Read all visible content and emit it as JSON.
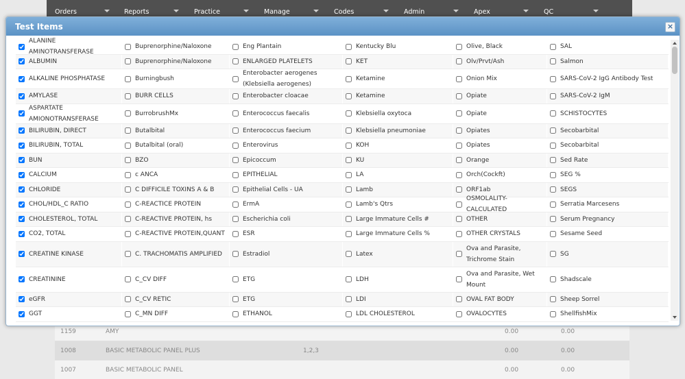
{
  "nav": [
    "Orders",
    "Reports",
    "Practice",
    "Manage",
    "Codes",
    "Admin",
    "Apex",
    "QC"
  ],
  "modal": {
    "title": "Test Items",
    "close_symbol": "×",
    "rows": [
      [
        [
          "ALANINE AMINOTRANSFERASE",
          true
        ],
        [
          "Buprenorphine/Naloxone",
          false
        ],
        [
          "Eng Plantain",
          false
        ],
        [
          "Kentucky Blu",
          false
        ],
        [
          "Olive, Black",
          false
        ],
        [
          "SAL",
          false
        ]
      ],
      [
        [
          "ALBUMIN",
          true
        ],
        [
          "Buprenorphine/Naloxone",
          false
        ],
        [
          "ENLARGED PLATELETS",
          false
        ],
        [
          "KET",
          false
        ],
        [
          "Olv/Prvt/Ash",
          false
        ],
        [
          "Salmon",
          false
        ]
      ],
      [
        [
          "ALKALINE PHOSPHATASE",
          true
        ],
        [
          "Burningbush",
          false
        ],
        [
          "Enterobacter aerogenes (Klebsiella aerogenes)",
          false
        ],
        [
          "Ketamine",
          false
        ],
        [
          "Onion Mix",
          false
        ],
        [
          "SARS-CoV-2 IgG Antibody Test",
          false
        ]
      ],
      [
        [
          "AMYLASE",
          true
        ],
        [
          "BURR CELLS",
          false
        ],
        [
          "Enterobacter cloacae",
          false
        ],
        [
          "Ketamine",
          false
        ],
        [
          "Opiate",
          false
        ],
        [
          "SARS-CoV-2 IgM",
          false
        ]
      ],
      [
        [
          "ASPARTATE AMIONOTRANSFERASE",
          true
        ],
        [
          "BurrobrushMx",
          false
        ],
        [
          "Enterococcus faecalis",
          false
        ],
        [
          "Klebsiella oxytoca",
          false
        ],
        [
          "Opiate",
          false
        ],
        [
          "SCHISTOCYTES",
          false
        ]
      ],
      [
        [
          "BILIRUBIN, DIRECT",
          true
        ],
        [
          "Butalbital",
          false
        ],
        [
          "Enterococcus faecium",
          false
        ],
        [
          "Klebsiella pneumoniae",
          false
        ],
        [
          "Opiates",
          false
        ],
        [
          "Secobarbital",
          false
        ]
      ],
      [
        [
          "BILIRUBIN, TOTAL",
          true
        ],
        [
          "Butalbital (oral)",
          false
        ],
        [
          "Enterovirus",
          false
        ],
        [
          "KOH",
          false
        ],
        [
          "Opiates",
          false
        ],
        [
          "Secobarbital",
          false
        ]
      ],
      [
        [
          "BUN",
          true
        ],
        [
          "BZO",
          false
        ],
        [
          "Epicoccum",
          false
        ],
        [
          "KU",
          false
        ],
        [
          "Orange",
          false
        ],
        [
          "Sed Rate",
          false
        ]
      ],
      [
        [
          "CALCIUM",
          true
        ],
        [
          "c ANCA",
          false
        ],
        [
          "EPITHELIAL",
          false
        ],
        [
          "LA",
          false
        ],
        [
          "Orch(Cockft)",
          false
        ],
        [
          "SEG %",
          false
        ]
      ],
      [
        [
          "CHLORIDE",
          true
        ],
        [
          "C DIFFICILE TOXINS A & B",
          false
        ],
        [
          "Epithelial Cells - UA",
          false
        ],
        [
          "Lamb",
          false
        ],
        [
          "ORF1ab",
          false
        ],
        [
          "SEGS",
          false
        ]
      ],
      [
        [
          "CHOL/HDL_C RATIO",
          true
        ],
        [
          "C-REACTICE PROTEIN",
          false
        ],
        [
          "ErmA",
          false
        ],
        [
          "Lamb's Qtrs",
          false
        ],
        [
          "OSMOLALITY-CALCULATED",
          false
        ],
        [
          "Serratia Marcesens",
          false
        ]
      ],
      [
        [
          "CHOLESTEROL, TOTAL",
          true
        ],
        [
          "C-REACTIVE PROTEIN, hs",
          false
        ],
        [
          "Escherichia coli",
          false
        ],
        [
          "Large Immature Cells #",
          false
        ],
        [
          "OTHER",
          false
        ],
        [
          "Serum Pregnancy",
          false
        ]
      ],
      [
        [
          "CO2, TOTAL",
          true
        ],
        [
          "C-REACTIVE PROTEIN,QUANT",
          false
        ],
        [
          "ESR",
          false
        ],
        [
          "Large Immature Cells %",
          false
        ],
        [
          "OTHER CRYSTALS",
          false
        ],
        [
          "Sesame Seed",
          false
        ]
      ],
      [
        [
          "CREATINE KINASE",
          true
        ],
        [
          "C. TRACHOMATIS AMPLIFIED",
          false
        ],
        [
          "Estradiol",
          false
        ],
        [
          "Latex",
          false
        ],
        [
          "Ova and Parasite, Trichrome Stain",
          false
        ],
        [
          "SG",
          false
        ]
      ],
      [
        [
          "CREATININE",
          true
        ],
        [
          "C_CV DIFF",
          false
        ],
        [
          "ETG",
          false
        ],
        [
          "LDH",
          false
        ],
        [
          "Ova and Parasite, Wet Mount",
          false
        ],
        [
          "Shadscale",
          false
        ]
      ],
      [
        [
          "eGFR",
          true
        ],
        [
          "C_CV RETIC",
          false
        ],
        [
          "ETG",
          false
        ],
        [
          "LDI",
          false
        ],
        [
          "OVAL FAT BODY",
          false
        ],
        [
          "Sheep Sorrel",
          false
        ]
      ],
      [
        [
          "GGT",
          true
        ],
        [
          "C_MN DIFF",
          false
        ],
        [
          "ETHANOL",
          false
        ],
        [
          "LDL CHOLESTEROL",
          false
        ],
        [
          "OVALOCYTES",
          false
        ],
        [
          "ShellfishMix",
          false
        ]
      ]
    ]
  },
  "bg_table": {
    "rows": [
      [
        "1159",
        "AMY",
        "",
        "0.00",
        "0.00"
      ],
      [
        "1008",
        "BASIC METABOLIC PANEL PLUS",
        "1,2,3",
        "0.00",
        "0.00"
      ],
      [
        "1007",
        "BASIC METABOLIC PANEL",
        "",
        "0.00",
        "0.00"
      ]
    ]
  }
}
